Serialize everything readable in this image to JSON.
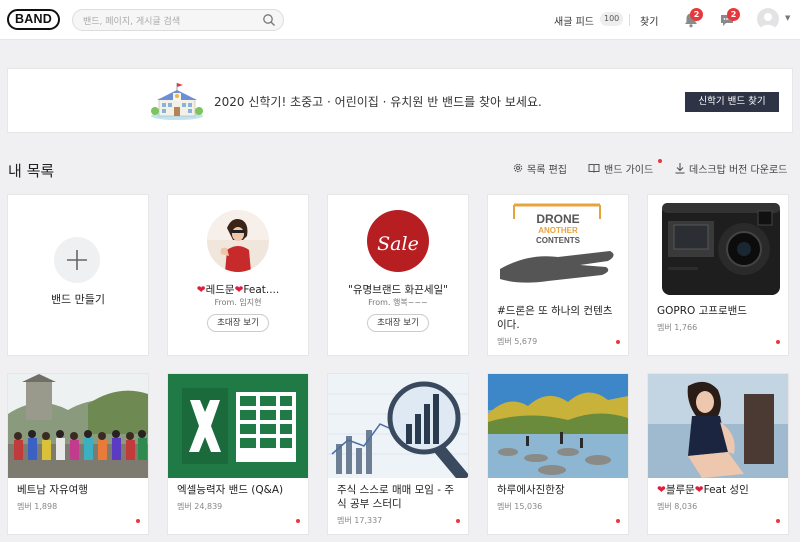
{
  "header": {
    "logo": "BAND",
    "search_placeholder": "밴드, 페이지, 게시글 검색",
    "new_feed_label": "새글 피드",
    "new_feed_count": "100",
    "find_label": "찾기",
    "notification_count": "2",
    "chat_count": "2"
  },
  "banner": {
    "text": "2020 신학기! 초중고 · 어린이집 · 유치원 반 밴드를 찾아 보세요.",
    "button": "신학기 밴드 찾기"
  },
  "section": {
    "title": "내 목록",
    "edit_list": "목록 편집",
    "band_guide": "밴드 가이드",
    "desktop_download": "데스크탑 버전 다운로드"
  },
  "create_card": {
    "label": "밴드 만들기"
  },
  "invites": [
    {
      "name": "레드문",
      "name_suffix": "Feat....",
      "from": "From. 임지현",
      "button": "초대장 보기"
    },
    {
      "name": "\"유명브랜드 화끈세일\"",
      "from": "From. 행복~~~",
      "button": "초대장 보기",
      "thumb_text": "Sale"
    }
  ],
  "bands": [
    {
      "title": "#드론은 또 하나의 컨텐츠이다.",
      "members": "멤버 5,679",
      "thumb_lines": [
        "DRONE",
        "ANOTHER",
        "CONTENTS"
      ]
    },
    {
      "title": "GOPRO 고프로밴드",
      "members": "멤버 1,766"
    },
    {
      "title": "베트남 자유여행",
      "members": "멤버 1,898"
    },
    {
      "title": "엑셀능력자 밴드 (Q&A)",
      "members": "멤버 24,839"
    },
    {
      "title": "주식 스스로 매매 모임 - 주식 공부 스터디",
      "members": "멤버 17,337"
    },
    {
      "title": "하루에사진한장",
      "members": "멤버 15,036"
    },
    {
      "title_prefix": "블루문",
      "title_suffix": "Feat 성인",
      "members": "멤버 8,036"
    }
  ],
  "colors": {
    "badge": "#e8383d",
    "banner_button": "#2e3445",
    "heart": "#e01e3c"
  }
}
